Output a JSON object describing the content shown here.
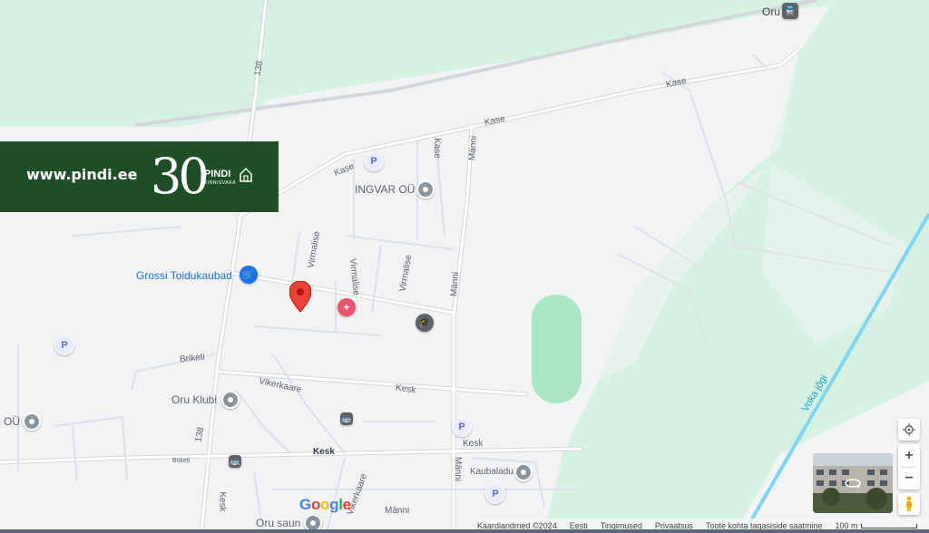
{
  "banner": {
    "url": "www.pindi.ee",
    "number": "30",
    "brand": "PINDI",
    "brand_sub": "KINNISVARA"
  },
  "map": {
    "roads": {
      "r138_top": "138",
      "r138_bottom": "138",
      "kase_west": "Kase",
      "kase_mid": "Kase",
      "kase_east": "Kase",
      "kase_vertical": "Kase",
      "manni_top": "Männi",
      "manni_mid": "Männi",
      "manni_bottom": "Männi",
      "manni_south": "Männi",
      "virmalise_1": "Virmalise",
      "virmalise_2": "Virmalise",
      "virmalise_3": "Virmalise",
      "briketi": "Briketi",
      "briketi_2": "Briketi",
      "vikerkaare": "Vikerkaare",
      "vikerkaare_2": "Vikerkaare",
      "kesk_1": "Kesk",
      "kesk_2": "Kesk",
      "kesk_3": "Kesk",
      "kesk_4": "Kesk",
      "river": "Voka jõgi"
    },
    "pois": {
      "oru_station": "Oru",
      "ingvar": "INGVAR OÜ",
      "grossi": "Grossi Toidukaubad",
      "oru_klubi": "Oru Klubi",
      "ou_left": "OÜ",
      "kaubaladu": "Kaubaladu",
      "oru_saun": "Oru saun"
    },
    "parking_symbol": "P",
    "google_logo": "Google"
  },
  "controls": {
    "zoom_in": "+",
    "zoom_out": "−"
  },
  "footer": {
    "map_data": "Kaardiandmed ©2024",
    "language": "Eesti",
    "terms": "Tingimused",
    "privacy": "Privaatsus",
    "feedback": "Toote kohta tagasiside saatmine",
    "scale": "100 m"
  },
  "colors": {
    "background": "#f1f3f4",
    "green_area": "#d4f1e1",
    "stadium": "#a8e6c4",
    "road": "#ffffff",
    "road_edge": "#dadce0",
    "river": "#7fd6f0",
    "banner": "#1f4f27",
    "pin_red": "#ea4335"
  }
}
